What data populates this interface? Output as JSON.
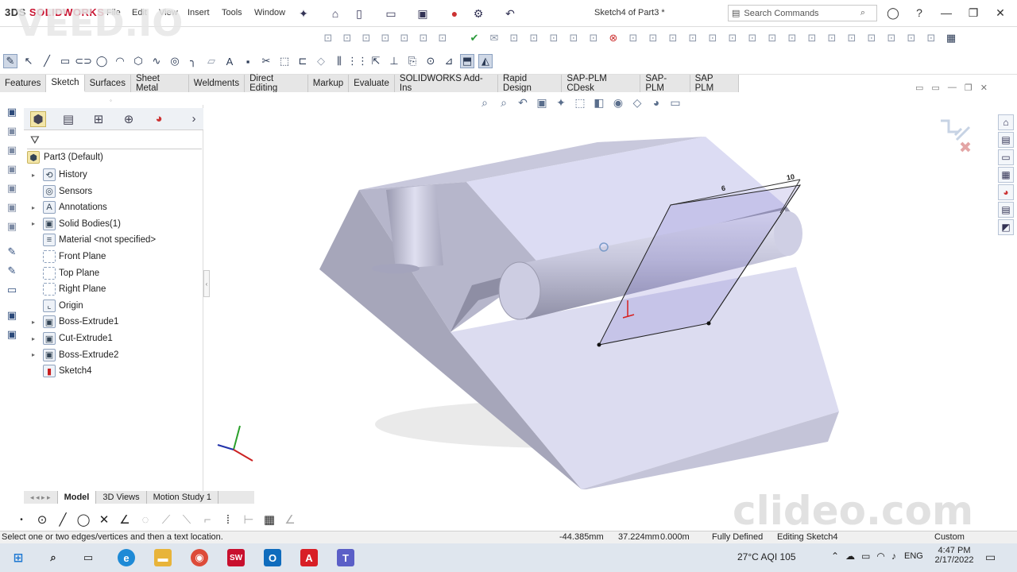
{
  "app": {
    "logo_prefix": "3DS",
    "logo_text": "SOLIDWORKS",
    "document_title": "Sketch4 of Part3 *",
    "search_placeholder": "Search Commands"
  },
  "menu": [
    "File",
    "Edit",
    "View",
    "Insert",
    "Tools",
    "Window"
  ],
  "tabs": [
    "Features",
    "Sketch",
    "Surfaces",
    "Sheet Metal",
    "Weldments",
    "Direct Editing",
    "Markup",
    "Evaluate",
    "SOLIDWORKS Add-Ins",
    "Rapid Design",
    "SAP-PLM CDesk",
    "SAP-PLM",
    "SAP PLM"
  ],
  "active_tab": "Sketch",
  "feature_tree": {
    "root": "Part3  (Default)",
    "items": [
      {
        "label": "History",
        "expand": true,
        "icon": "history-icon"
      },
      {
        "label": "Sensors",
        "expand": false,
        "icon": "sensor-icon"
      },
      {
        "label": "Annotations",
        "expand": true,
        "icon": "annotation-icon"
      },
      {
        "label": "Solid Bodies(1)",
        "expand": true,
        "icon": "solid-bodies-icon"
      },
      {
        "label": "Material <not specified>",
        "expand": false,
        "icon": "material-icon"
      },
      {
        "label": "Front Plane",
        "expand": false,
        "icon": "plane-icon"
      },
      {
        "label": "Top Plane",
        "expand": false,
        "icon": "plane-icon"
      },
      {
        "label": "Right Plane",
        "expand": false,
        "icon": "plane-icon"
      },
      {
        "label": "Origin",
        "expand": false,
        "icon": "origin-icon"
      },
      {
        "label": "Boss-Extrude1",
        "expand": true,
        "icon": "extrude-icon"
      },
      {
        "label": "Cut-Extrude1",
        "expand": true,
        "icon": "cut-extrude-icon"
      },
      {
        "label": "Boss-Extrude2",
        "expand": true,
        "icon": "extrude-icon"
      },
      {
        "label": "Sketch4",
        "expand": false,
        "icon": "sketch-icon"
      }
    ]
  },
  "bottom_tabs": [
    "Model",
    "3D Views",
    "Motion Study 1"
  ],
  "active_bottom_tab": "Model",
  "status": {
    "prompt": "Select one or two edges/vertices and then a text location.",
    "x": "-44.385mm",
    "y": "37.224mm",
    "z": "0.000m",
    "defined": "Fully Defined",
    "editing": "Editing Sketch4",
    "units": "Custom"
  },
  "taskbar": {
    "weather": "27°C  AQI 105",
    "lang": "ENG",
    "time": "4:47 PM",
    "date": "2/17/2022"
  },
  "watermarks": {
    "top": "VEED.IO",
    "bottom": "clideo.com"
  },
  "model_dimensions": [
    "6",
    "10"
  ],
  "colors": {
    "accent": "#c8102e",
    "model_face": "#dcdcf3",
    "model_dark": "#a4a4b8",
    "model_mid": "#c0c0d6",
    "sketch_plane": "#6e62c8"
  }
}
